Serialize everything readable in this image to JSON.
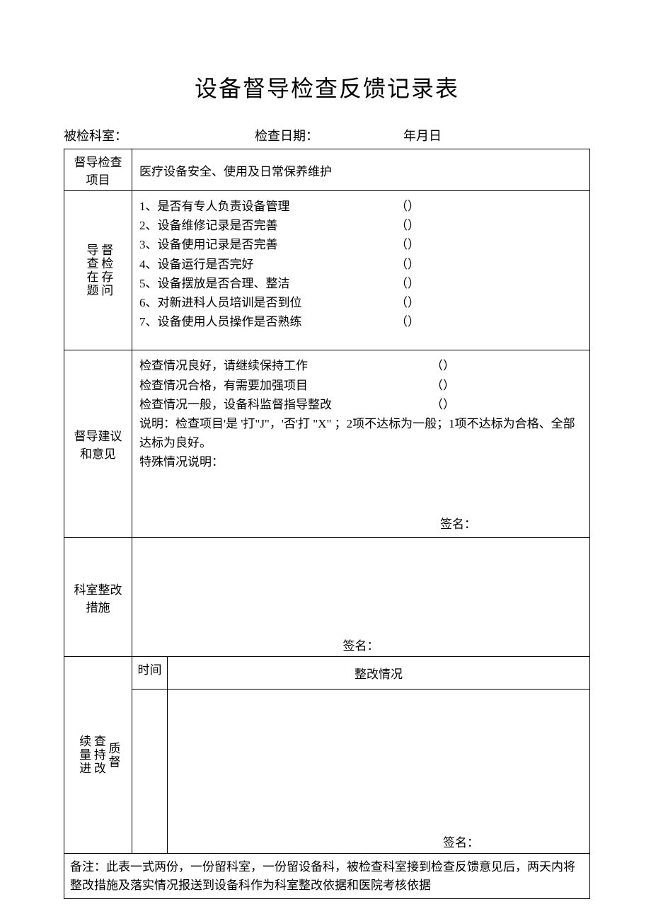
{
  "title": "设备督导检查反馈记录表",
  "header": {
    "dept_label": "被检科室：",
    "date_label": "检查日期：",
    "date_value": "年月日"
  },
  "rows": {
    "items_label": "督导检查项目",
    "items_value": "医疗设备安全、使用及日常保养维护",
    "problems_label_a": "导查在题",
    "problems_label_b": "督检存问",
    "checks": [
      {
        "text": "1、是否有专人负责设备管理",
        "paren": "（）"
      },
      {
        "text": "2、设备维修记录是否完善",
        "paren": "（）"
      },
      {
        "text": "3、设备使用记录是否完善",
        "paren": "（）"
      },
      {
        "text": "4、设备运行是否完好",
        "paren": "（）"
      },
      {
        "text": "5、设备摆放是否合理、整洁",
        "paren": "（）"
      },
      {
        "text": "6、对新进科人员培训是否到位",
        "paren": "（）"
      },
      {
        "text": "7、设备使用人员操作是否熟练",
        "paren": "（）"
      }
    ],
    "advice_label": "督导建议和意见",
    "advice_lines": [
      {
        "text": "检查情况良好，请继续保持工作",
        "paren": "（）"
      },
      {
        "text": "检查情况合格，有需要加强项目",
        "paren": "（）"
      },
      {
        "text": "检查情况一般，设备科监督指导整改",
        "paren": "（）"
      }
    ],
    "advice_note": "说明：检查项目'是 '打\"J\"，'否'打 \"X\" ；2项不达标为一般；1项不达标为合格、全部达标为良好。",
    "special_note": "特殊情况说明：",
    "signature": "签名：",
    "rect_label": "科室整改措施",
    "cont_label_a": "续量进",
    "cont_label_b": "查持改",
    "cont_label_c": "质督",
    "time_hdr": "时间",
    "status_hdr": "整改情况",
    "footer_note": "备注：此表一式两份，一份留科室，一份留设备科，被检查科室接到检查反馈意见后，两天内将整改措施及落实情况报送到设备科作为科室整改依据和医院考核依据"
  }
}
